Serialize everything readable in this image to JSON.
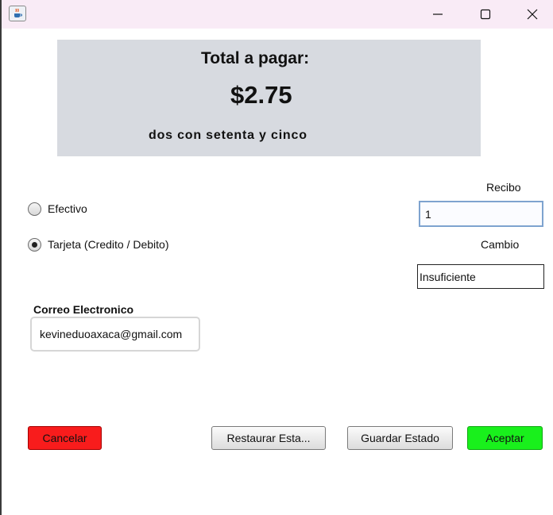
{
  "window": {
    "app_icon": "java-cup-icon",
    "minimize_icon": "minimize-icon",
    "maximize_icon": "maximize-icon",
    "close_icon": "close-icon"
  },
  "total": {
    "title": "Total a pagar:",
    "amount": "$2.75",
    "amount_words": "dos con setenta y cinco"
  },
  "payment_method": {
    "options": [
      {
        "label": "Efectivo",
        "selected": false
      },
      {
        "label": "Tarjeta (Credito / Debito)",
        "selected": true
      }
    ]
  },
  "recibo": {
    "label": "Recibo",
    "value": "1"
  },
  "cambio": {
    "label": "Cambio",
    "value": "Insuficiente"
  },
  "correo": {
    "label": "Correo Electronico",
    "value": "kevineduoaxaca@gmail.com"
  },
  "buttons": {
    "cancelar": "Cancelar",
    "restaurar": "Restaurar Esta...",
    "guardar": "Guardar Estado",
    "aceptar": "Aceptar"
  },
  "colors": {
    "panel_bg": "#d7dae0",
    "titlebar_bg": "#f9ebf6",
    "cancel_bg": "#f81c1c",
    "accept_bg": "#19f01c",
    "focus_border": "#7ea3cf"
  }
}
